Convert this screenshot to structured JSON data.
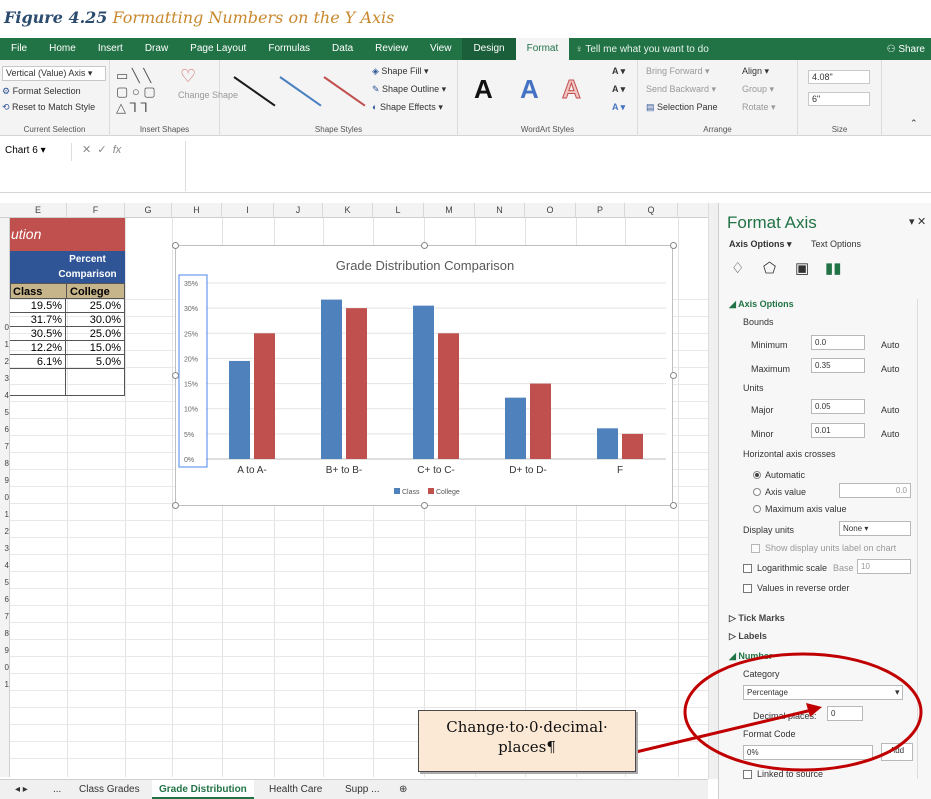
{
  "caption": {
    "figure": "Figure 4.25",
    "text": "Formatting Numbers on the Y Axis"
  },
  "ribbon": {
    "tabs": [
      "File",
      "Home",
      "Insert",
      "Draw",
      "Page Layout",
      "Formulas",
      "Data",
      "Review",
      "View",
      "Design",
      "Format"
    ],
    "active_tab": "Format",
    "tell_me": "Tell me what you want to do",
    "share": "Share",
    "current_selection": {
      "dropdown": "Vertical (Value) Axis",
      "format_selection": "Format Selection",
      "reset": "Reset to Match Style",
      "label": "Current Selection"
    },
    "insert_shapes": {
      "change_shape": "Change Shape",
      "label": "Insert Shapes"
    },
    "shape_styles": {
      "fill": "Shape Fill",
      "outline": "Shape Outline",
      "effects": "Shape Effects",
      "label": "Shape Styles",
      "line_colors": [
        "#1a1a1a",
        "#4a7fc1",
        "#c0504d"
      ]
    },
    "wordart": {
      "letters": [
        "A",
        "A",
        "A"
      ],
      "label": "WordArt Styles"
    },
    "arrange": {
      "bring_forward": "Bring Forward",
      "send_backward": "Send Backward",
      "selection_pane": "Selection Pane",
      "align": "Align",
      "group": "Group",
      "rotate": "Rotate",
      "label": "Arrange"
    },
    "size": {
      "height": "4.08\"",
      "width": "6\"",
      "label": "Size"
    }
  },
  "formula_bar": {
    "name_box": "Chart 6",
    "fx": "fx"
  },
  "sheet": {
    "columns": [
      "E",
      "F",
      "G",
      "H",
      "I",
      "J",
      "K",
      "L",
      "M",
      "N",
      "O",
      "P",
      "Q"
    ],
    "rows": [
      "0",
      "1",
      "2",
      "3",
      "4",
      "5",
      "6",
      "7",
      "8",
      "9",
      "0",
      "1",
      "2",
      "3",
      "4",
      "5",
      "6",
      "7",
      "8",
      "9",
      "0",
      "1"
    ],
    "table": {
      "title": "ution",
      "header": "Percent Comparison",
      "col_class": "Class",
      "col_college": "College",
      "class_values": [
        "19.5%",
        "31.7%",
        "30.5%",
        "12.2%",
        "6.1%"
      ],
      "college_values": [
        "25.0%",
        "30.0%",
        "25.0%",
        "15.0%",
        "5.0%"
      ]
    },
    "tabs": [
      "Class Grades",
      "Grade Distribution",
      "Health Care",
      "Supp ..."
    ],
    "active_tab": "Grade Distribution",
    "tab_ellipsis": "..."
  },
  "chart_data": {
    "type": "bar",
    "title": "Grade Distribution Comparison",
    "categories": [
      "A to A-",
      "B+ to B-",
      "C+ to C-",
      "D+ to D-",
      "F"
    ],
    "series": [
      {
        "name": "Class",
        "color": "#4f81bd",
        "values": [
          0.195,
          0.317,
          0.305,
          0.122,
          0.061
        ]
      },
      {
        "name": "College",
        "color": "#c0504d",
        "values": [
          0.25,
          0.3,
          0.25,
          0.15,
          0.05
        ]
      }
    ],
    "ylim": [
      0,
      0.35
    ],
    "yticks": [
      0,
      0.05,
      0.1,
      0.15,
      0.2,
      0.25,
      0.3,
      0.35
    ],
    "ytick_labels": [
      "0%",
      "5%",
      "10%",
      "15%",
      "20%",
      "25%",
      "30%",
      "35%"
    ],
    "grid": true,
    "legend": "bottom"
  },
  "pane": {
    "title": "Format Axis",
    "tab_axis": "Axis Options",
    "tab_text": "Text Options",
    "axis_options": "Axis Options",
    "bounds": "Bounds",
    "minimum": {
      "label": "Minimum",
      "value": "0.0",
      "auto": "Auto"
    },
    "maximum": {
      "label": "Maximum",
      "value": "0.35",
      "auto": "Auto"
    },
    "units": "Units",
    "major": {
      "label": "Major",
      "value": "0.05",
      "auto": "Auto"
    },
    "minor": {
      "label": "Minor",
      "value": "0.01",
      "auto": "Auto"
    },
    "crosses": "Horizontal axis crosses",
    "automatic": "Automatic",
    "axis_value": "Axis value",
    "axis_value_num": "0.0",
    "max_axis_value": "Maximum axis value",
    "display_units": "Display units",
    "display_units_value": "None",
    "show_units_label": "Show display units label on chart",
    "log_scale": "Logarithmic scale",
    "base": "Base",
    "base_value": "10",
    "reverse": "Values in reverse order",
    "tick_marks": "Tick Marks",
    "labels": "Labels",
    "number": "Number",
    "category": "Category",
    "category_value": "Percentage",
    "decimal_places": "Decimal places:",
    "decimal_value": "0",
    "format_code": "Format Code",
    "format_code_value": "0%",
    "add": "Add",
    "linked": "Linked to source"
  },
  "callout": {
    "text": "Change·to·0·decimal· places¶"
  }
}
